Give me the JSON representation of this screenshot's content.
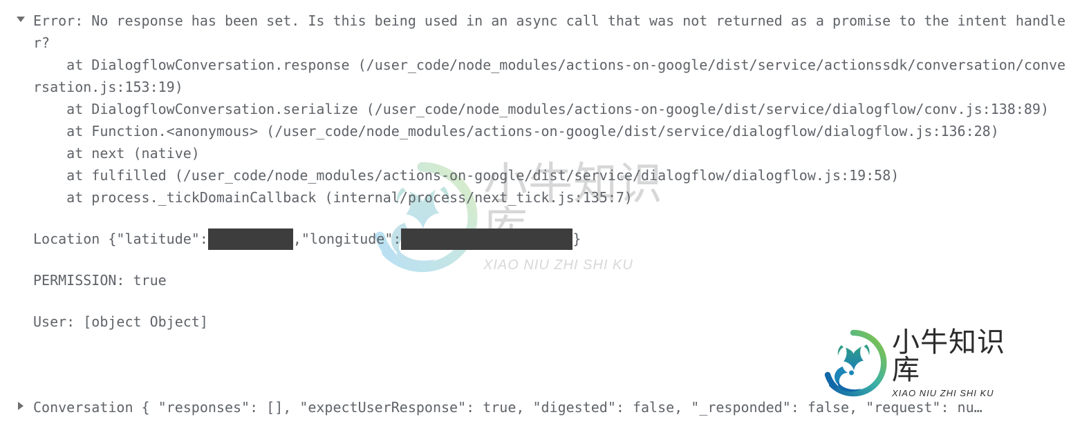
{
  "console": {
    "entries": [
      {
        "id": "error-entry",
        "disclosure": "triangle-down-icon",
        "expanded": true,
        "message": "Error: No response has been set. Is this being used in an async call that was not returned as a promise to the intent handler?",
        "stack": [
          "    at DialogflowConversation.response (/user_code/node_modules/actions-on-google/dist/service/actionssdk/conversation/conversation.js:153:19)",
          "    at DialogflowConversation.serialize (/user_code/node_modules/actions-on-google/dist/service/dialogflow/conv.js:138:89)",
          "    at Function.<anonymous> (/user_code/node_modules/actions-on-google/dist/service/dialogflow/dialogflow.js:136:28)",
          "    at next (native)",
          "    at fulfilled (/user_code/node_modules/actions-on-google/dist/service/dialogflow/dialogflow.js:19:58)",
          "    at process._tickDomainCallback (internal/process/next_tick.js:135:7)"
        ]
      }
    ],
    "location_line": {
      "label": "Location",
      "prefix": " {\"latitude\":",
      "latitude_value": "",
      "middle": ",\"longitude\":",
      "longitude_value": "",
      "suffix": "}"
    },
    "permission_line": "PERMISSION: true",
    "user_line": "User: [object Object]",
    "last_entry": {
      "disclosure": "triangle-right-icon",
      "expanded": false,
      "text": "Conversation { \"responses\": [], \"expectUserResponse\": true, \"digested\": false, \"_responded\": false, \"request\": nu…"
    }
  },
  "watermark": {
    "cn_text": "小牛知识库",
    "en_text": "XIAO NIU ZHI SHI KU",
    "logo_icon": "ox-in-circle-logo",
    "ring_color_top": "#8dc63f",
    "ring_color_bottom": "#29a3d5",
    "ox_color": "#3aa89b"
  },
  "colors": {
    "background": "#ffffff",
    "text": "#5f6368",
    "redaction": "#3d3d3d",
    "disclosure": "#6e6e6e"
  }
}
